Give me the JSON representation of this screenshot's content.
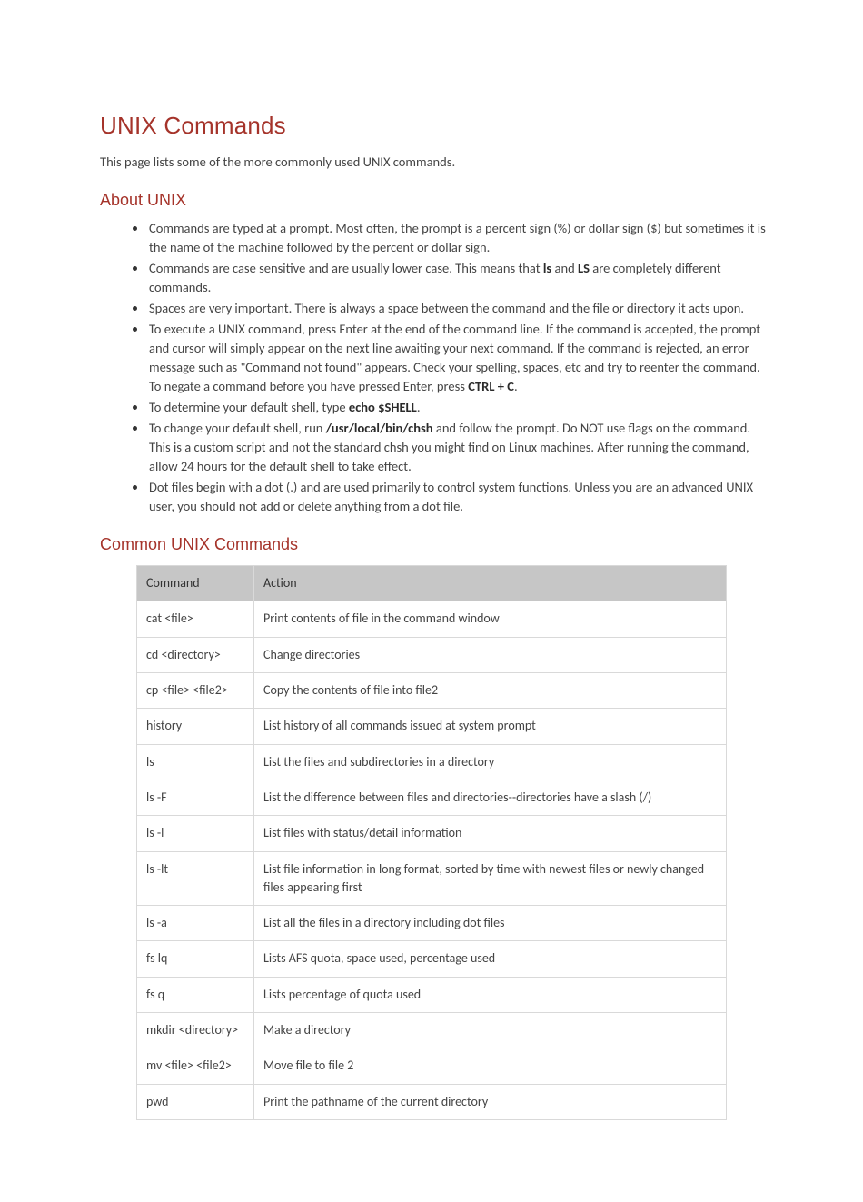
{
  "title": "UNIX Commands",
  "intro": "This page lists some of the more commonly used UNIX commands.",
  "about": {
    "heading": "About UNIX",
    "items": [
      {
        "type": "plain",
        "text": "Commands are typed at a prompt. Most often, the prompt is a percent sign (%) or dollar sign ($) but sometimes it is the name of the machine followed by the percent or dollar sign."
      },
      {
        "type": "case",
        "pre": "Commands are case sensitive and are usually lower case. This means that ",
        "b1": "ls",
        "mid": " and ",
        "b2": "LS",
        "post": " are completely different commands."
      },
      {
        "type": "plain",
        "text": "Spaces are very important. There is always a space between the command and the file or directory it acts upon."
      },
      {
        "type": "ctrlc",
        "pre": "To execute a UNIX command, press Enter at the end of the command line. If the command is accepted, the prompt and cursor will simply appear on the next line awaiting your next command. If the command is rejected, an error message such as \"Command not found\" appears. Check your spelling, spaces, etc and try to reenter the command. To negate a command before you have pressed Enter, press ",
        "b1": "CTRL + C",
        "post": "."
      },
      {
        "type": "echo",
        "pre": "To determine your default shell, type ",
        "b1": "echo $SHELL",
        "post": "."
      },
      {
        "type": "chsh",
        "pre": "To change your default shell, run ",
        "b1": "/usr/local/bin/chsh",
        "post": " and follow the prompt. Do NOT use flags on the command. This is a custom script and not the standard chsh you might find on Linux machines. After running the command, allow 24 hours for the default shell to take effect."
      },
      {
        "type": "plain",
        "text": "Dot files begin with a dot (.) and are used primarily to control system functions. Unless you are an advanced UNIX user, you should not add or delete anything from a dot file."
      }
    ]
  },
  "commands": {
    "heading": "Common UNIX Commands",
    "header_cmd": "Command",
    "header_action": "Action",
    "rows": [
      {
        "cmd": "cat <file>",
        "action": "Print contents of file in the command window"
      },
      {
        "cmd": "cd <directory>",
        "action": "Change directories"
      },
      {
        "cmd": "cp <file> <file2>",
        "action": "Copy the contents of file into file2"
      },
      {
        "cmd": "history",
        "action": "List history of all commands issued at system prompt"
      },
      {
        "cmd": "ls",
        "action": "List the files and subdirectories in a directory"
      },
      {
        "cmd": "ls -F",
        "action": "List the difference between files and directories--directories have a slash (/)"
      },
      {
        "cmd": "ls -l",
        "action": "List files with status/detail information"
      },
      {
        "cmd": "ls -lt",
        "action": "List file information in long format, sorted by time with newest files or newly changed files appearing first"
      },
      {
        "cmd": "ls -a",
        "action": "List all the files in a directory including dot files"
      },
      {
        "cmd": "fs lq",
        "action": "Lists AFS quota, space used, percentage used"
      },
      {
        "cmd": "fs q",
        "action": "Lists percentage of quota used"
      },
      {
        "cmd": "mkdir <directory>",
        "action": "Make a directory"
      },
      {
        "cmd": "mv <file> <file2>",
        "action": "Move file to file 2"
      },
      {
        "cmd": "pwd",
        "action": "Print the pathname of the current directory"
      }
    ]
  }
}
